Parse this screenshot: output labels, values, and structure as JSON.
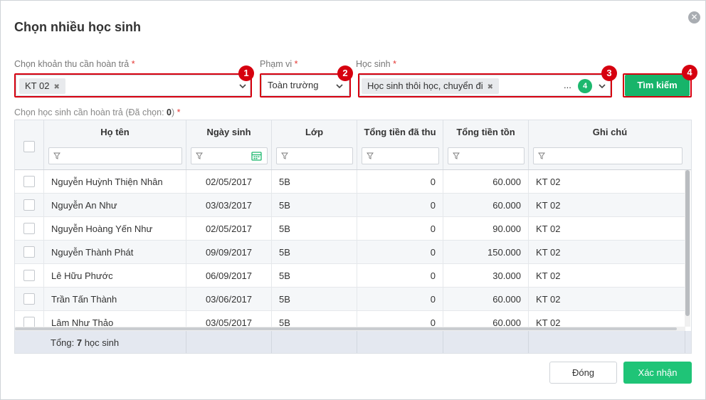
{
  "dialog": {
    "title": "Chọn nhiều học sinh",
    "close_glyph": "✕"
  },
  "filters": {
    "fee_label": "Chọn khoản thu cần hoàn trả",
    "fee_tag": "KT 02",
    "scope_label": "Phạm vi",
    "scope_value": "Toàn trường",
    "student_label": "Học sinh",
    "student_tag": "Học sinh thôi học, chuyển đi",
    "student_more": "...",
    "student_count": "4",
    "required_mark": "*",
    "search_button": "Tìm kiếm",
    "step_badges": [
      "1",
      "2",
      "3",
      "4"
    ]
  },
  "table": {
    "caption_prefix": "Chọn học sinh cần hoàn trả (Đã chọn: ",
    "caption_count": "0",
    "caption_suffix": ")",
    "columns": [
      "Họ tên",
      "Ngày sinh",
      "Lớp",
      "Tổng tiền đã thu",
      "Tổng tiền tồn",
      "Ghi chú"
    ],
    "rows": [
      [
        "Nguyễn Huỳnh Thiện Nhân",
        "02/05/2017",
        "5B",
        "0",
        "60.000",
        "KT 02"
      ],
      [
        "Nguyễn An Như",
        "03/03/2017",
        "5B",
        "0",
        "60.000",
        "KT 02"
      ],
      [
        "Nguyễn Hoàng Yến Như",
        "02/05/2017",
        "5B",
        "0",
        "90.000",
        "KT 02"
      ],
      [
        "Nguyễn Thành Phát",
        "09/09/2017",
        "5B",
        "0",
        "150.000",
        "KT 02"
      ],
      [
        "Lê Hữu Phước",
        "06/09/2017",
        "5B",
        "0",
        "30.000",
        "KT 02"
      ],
      [
        "Trần Tấn Thành",
        "03/06/2017",
        "5B",
        "0",
        "60.000",
        "KT 02"
      ],
      [
        "Lâm Như Thảo",
        "03/05/2017",
        "5B",
        "0",
        "60.000",
        "KT 02"
      ]
    ],
    "footer_prefix": "Tổng: ",
    "footer_count": "7",
    "footer_suffix": " học sinh"
  },
  "actions": {
    "close": "Đóng",
    "confirm": "Xác nhận"
  },
  "colors": {
    "accent_green": "#17b46a",
    "highlight_red": "#d6000f"
  }
}
